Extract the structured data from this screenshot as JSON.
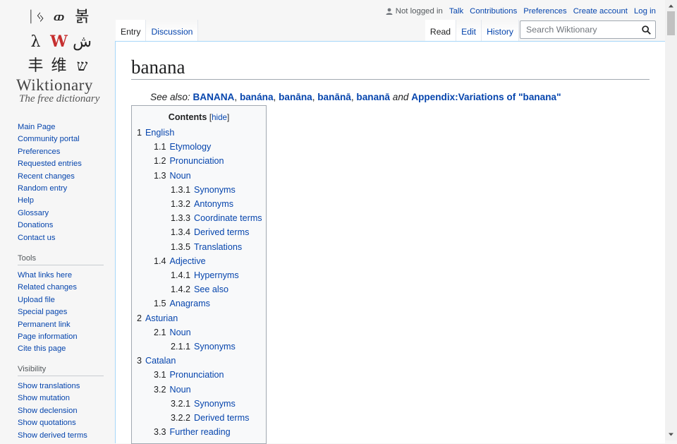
{
  "logo": {
    "glyphs": [
      "ᛁᛃ",
      "ወ",
      "볽",
      "λ",
      "W",
      "ش",
      "丰",
      "维",
      "ש"
    ],
    "wordmark": "Wiktionary",
    "tagline": "The free dictionary"
  },
  "navigation": {
    "items": [
      "Main Page",
      "Community portal",
      "Preferences",
      "Requested entries",
      "Recent changes",
      "Random entry",
      "Help",
      "Glossary",
      "Donations",
      "Contact us"
    ]
  },
  "tools": {
    "heading": "Tools",
    "items": [
      "What links here",
      "Related changes",
      "Upload file",
      "Special pages",
      "Permanent link",
      "Page information",
      "Cite this page"
    ]
  },
  "visibility": {
    "heading": "Visibility",
    "items": [
      "Show translations",
      "Show mutation",
      "Show declension",
      "Show quotations",
      "Show derived terms"
    ]
  },
  "personal": {
    "not_logged_in": "Not logged in",
    "talk": "Talk",
    "contributions": "Contributions",
    "preferences": "Preferences",
    "create_account": "Create account",
    "log_in": "Log in"
  },
  "tabs": {
    "entry": "Entry",
    "discussion": "Discussion",
    "read": "Read",
    "edit": "Edit",
    "history": "History"
  },
  "search": {
    "placeholder": "Search Wiktionary"
  },
  "page": {
    "title": "banana",
    "see_also": {
      "label": "See also:",
      "links": [
        "BANANA",
        "banána",
        "banāna",
        "banānā",
        "bananā"
      ],
      "connector": "and",
      "appendix": "Appendix:Variations of \"banana\""
    }
  },
  "toc": {
    "title": "Contents",
    "hide": "hide",
    "entries": [
      {
        "num": "1",
        "label": "English",
        "level": 1
      },
      {
        "num": "1.1",
        "label": "Etymology",
        "level": 2
      },
      {
        "num": "1.2",
        "label": "Pronunciation",
        "level": 2
      },
      {
        "num": "1.3",
        "label": "Noun",
        "level": 2
      },
      {
        "num": "1.3.1",
        "label": "Synonyms",
        "level": 3
      },
      {
        "num": "1.3.2",
        "label": "Antonyms",
        "level": 3
      },
      {
        "num": "1.3.3",
        "label": "Coordinate terms",
        "level": 3
      },
      {
        "num": "1.3.4",
        "label": "Derived terms",
        "level": 3
      },
      {
        "num": "1.3.5",
        "label": "Translations",
        "level": 3
      },
      {
        "num": "1.4",
        "label": "Adjective",
        "level": 2
      },
      {
        "num": "1.4.1",
        "label": "Hypernyms",
        "level": 3
      },
      {
        "num": "1.4.2",
        "label": "See also",
        "level": 3
      },
      {
        "num": "1.5",
        "label": "Anagrams",
        "level": 2
      },
      {
        "num": "2",
        "label": "Asturian",
        "level": 1
      },
      {
        "num": "2.1",
        "label": "Noun",
        "level": 2
      },
      {
        "num": "2.1.1",
        "label": "Synonyms",
        "level": 3
      },
      {
        "num": "3",
        "label": "Catalan",
        "level": 1
      },
      {
        "num": "3.1",
        "label": "Pronunciation",
        "level": 2
      },
      {
        "num": "3.2",
        "label": "Noun",
        "level": 2
      },
      {
        "num": "3.2.1",
        "label": "Synonyms",
        "level": 3
      },
      {
        "num": "3.2.2",
        "label": "Derived terms",
        "level": 3
      },
      {
        "num": "3.3",
        "label": "Further reading",
        "level": 2
      }
    ]
  },
  "colors": {
    "link": "#0645ad",
    "border": "#a7d7f9"
  }
}
